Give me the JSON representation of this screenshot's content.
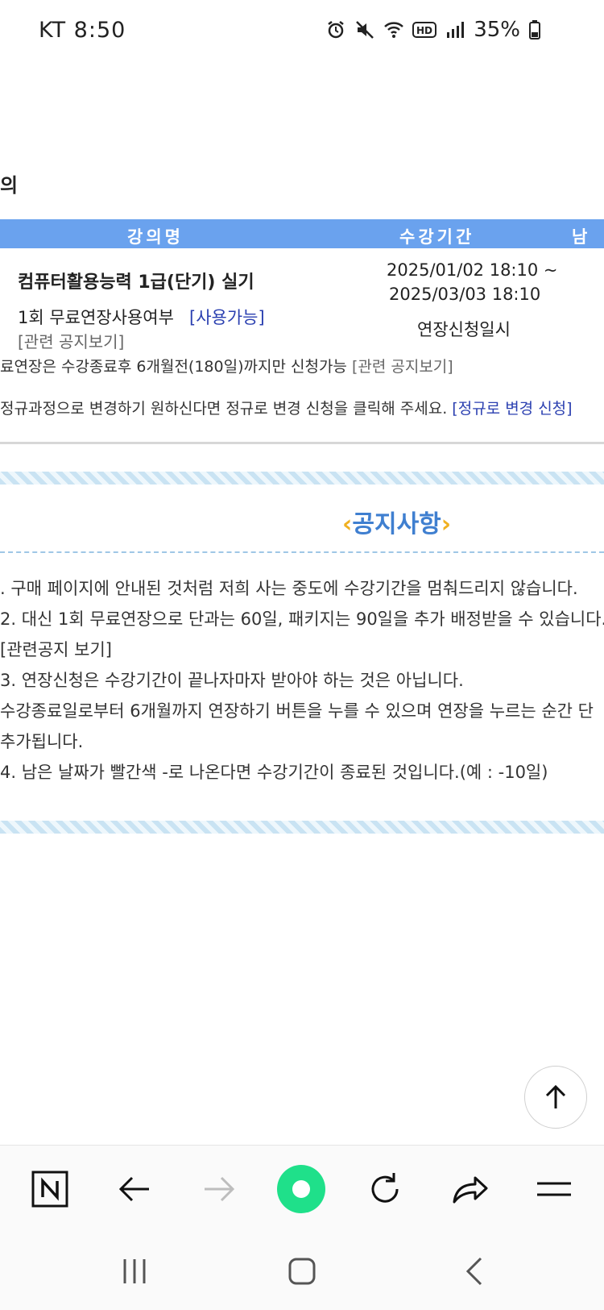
{
  "status_bar": {
    "carrier_time": "KT 8:50",
    "battery": "35%",
    "icons": [
      "alarm-icon",
      "mute-icon",
      "wifi-icon",
      "hd-icon",
      "signal-icon",
      "battery-icon"
    ]
  },
  "page": {
    "heading_fragment": "의",
    "table": {
      "headers": [
        "강의명",
        "수강기간",
        "남은"
      ],
      "course_title": "컴퓨터활용능력 1급(단기) 실기",
      "period_start": "2025/01/02 18:10 ~",
      "period_end": "2025/03/03 18:10",
      "ext_label": "1회 무료연장사용여부",
      "ext_status": "[사용가능]",
      "notice_link": "[관련 공지보기]",
      "ext_apply": "연장신청일시",
      "line1_text": "료연장은 수강종료후 6개월전(180일)까지만 신청가능",
      "line1_link": "[관련 공지보기]",
      "line2_text": "정규과정으로 변경하기 원하신다면 정규로 변경 신청을 클릭해 주세요.",
      "line2_link": "[정규로 변경 신청]"
    },
    "notice": {
      "title": "공지사항",
      "lines": [
        ". 구매 페이지에 안내된 것처럼 저희 사는 중도에 수강기간을 멈춰드리지 않습니다.",
        "2. 대신 1회 무료연장으로 단과는 60일, 패키지는 90일을 추가 배정받을 수 있습니다.",
        "  [관련공지 보기]",
        "3. 연장신청은 수강기간이 끝나자마자 받아야 하는 것은 아닙니다.",
        "  수강종료일로부터 6개월까지 연장하기 버튼을 누를 수 있으며 연장을 누르는 순간 단",
        "  추가됩니다.",
        "4. 남은 날짜가 빨간색 -로 나온다면 수강기간이 종료된 것입니다.(예 : -10일)"
      ]
    }
  },
  "toolbar": {
    "icons": [
      "naver-home-icon",
      "back-arrow-icon",
      "forward-arrow-icon",
      "green-dot-icon",
      "refresh-icon",
      "share-icon",
      "menu-icon"
    ],
    "accent": "#1fe08a"
  },
  "navbar": {
    "icons": [
      "recent-apps-icon",
      "home-icon",
      "back-icon"
    ]
  }
}
